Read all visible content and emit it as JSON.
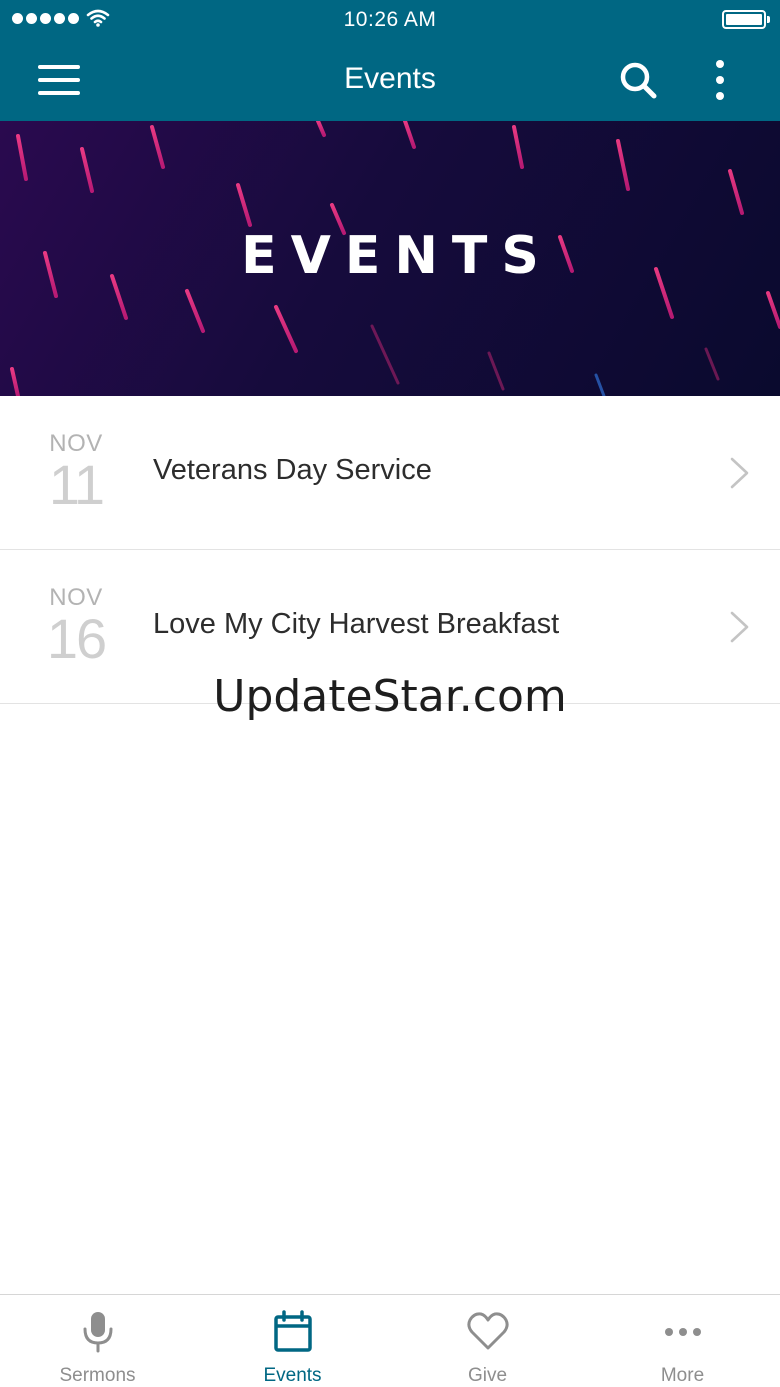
{
  "colors": {
    "accent": "#006783",
    "inactive": "#8e8e8e"
  },
  "status_bar": {
    "time": "10:26 AM"
  },
  "nav": {
    "title": "Events",
    "icons": [
      "hamburger-menu-icon",
      "search-icon",
      "more-vertical-icon"
    ]
  },
  "banner": {
    "title": "EVENTS"
  },
  "events": [
    {
      "month": "NOV",
      "day": "11",
      "title": "Veterans Day Service"
    },
    {
      "month": "NOV",
      "day": "16",
      "title": "Love My City Harvest Breakfast"
    }
  ],
  "watermark": "UpdateStar.com",
  "tabs": [
    {
      "label": "Sermons",
      "icon": "microphone-icon",
      "active": false
    },
    {
      "label": "Events",
      "icon": "calendar-icon",
      "active": true
    },
    {
      "label": "Give",
      "icon": "heart-icon",
      "active": false
    },
    {
      "label": "More",
      "icon": "ellipsis-icon",
      "active": false
    }
  ]
}
